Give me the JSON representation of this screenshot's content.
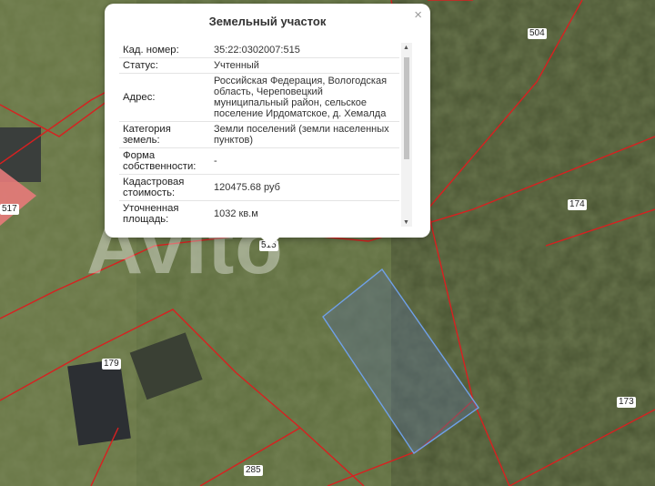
{
  "popup": {
    "title": "Земельный участок",
    "rows": [
      {
        "label": "Кад. номер:",
        "value": "35:22:0302007:515"
      },
      {
        "label": "Статус:",
        "value": "Учтенный"
      },
      {
        "label": "Адрес:",
        "value": "Российская Федерация, Вологодская область, Череповецкий муниципальный район, сельское поселение Ирдоматское, д. Хемалда"
      },
      {
        "label": "Категория земель:",
        "value": "Земли поселений (земли населенных пунктов)"
      },
      {
        "label": "Форма собственности:",
        "value": "-"
      },
      {
        "label": "Кадастровая стоимость:",
        "value": "120475.68 руб"
      },
      {
        "label": "Уточненная площадь:",
        "value": "1032 кв.м"
      }
    ]
  },
  "map": {
    "labels": {
      "l504": "504",
      "l517": "517",
      "l174": "174",
      "l515": "515",
      "l179": "179",
      "l173": "173",
      "l285": "285"
    },
    "watermark": "Avito"
  },
  "colors": {
    "boundary": "#d82020",
    "selected": "#6fa0e8",
    "highlight": "#e77a7a"
  }
}
